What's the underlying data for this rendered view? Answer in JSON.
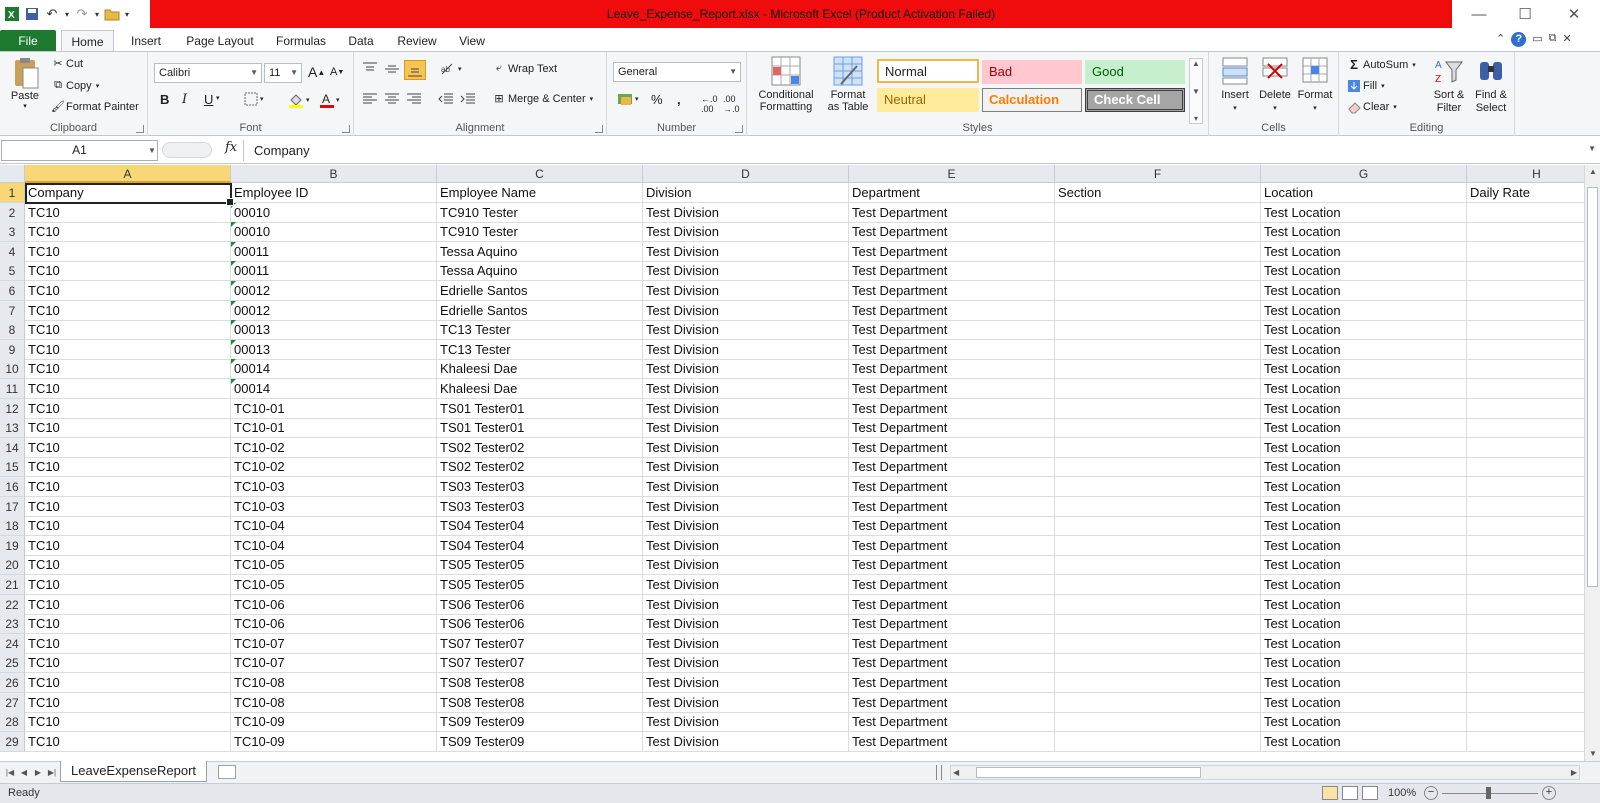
{
  "titlebar": {
    "title": "Leave_Expense_Report.xlsx  -  Microsoft Excel (Product Activation Failed)"
  },
  "tabs": {
    "file": "File",
    "items": [
      "Home",
      "Insert",
      "Page Layout",
      "Formulas",
      "Data",
      "Review",
      "View"
    ]
  },
  "ribbon": {
    "clipboard": {
      "label": "Clipboard",
      "paste": "Paste",
      "cut": "Cut",
      "copy": "Copy",
      "format_painter": "Format Painter"
    },
    "font": {
      "label": "Font",
      "name": "Calibri",
      "size": "11"
    },
    "alignment": {
      "label": "Alignment",
      "wrap": "Wrap Text",
      "merge": "Merge & Center"
    },
    "number": {
      "label": "Number",
      "format": "General"
    },
    "styles": {
      "label": "Styles",
      "conditional": [
        "Conditional",
        "Formatting"
      ],
      "format_table": [
        "Format",
        "as Table"
      ],
      "normal": "Normal",
      "bad": "Bad",
      "good": "Good",
      "neutral": "Neutral",
      "calculation": "Calculation",
      "check": "Check Cell"
    },
    "cells": {
      "label": "Cells",
      "insert": "Insert",
      "delete": "Delete",
      "format": "Format"
    },
    "editing": {
      "label": "Editing",
      "autosum": "AutoSum",
      "fill": "Fill",
      "clear": "Clear",
      "sort": [
        "Sort &",
        "Filter"
      ],
      "find": [
        "Find &",
        "Select"
      ]
    }
  },
  "formula_bar": {
    "name_box": "A1",
    "fx": "fx",
    "value": "Company"
  },
  "sheet": {
    "columns": [
      "A",
      "B",
      "C",
      "D",
      "E",
      "F",
      "G",
      "H"
    ],
    "row_numbers": [
      "1",
      "2",
      "3",
      "4",
      "5",
      "6",
      "7",
      "8",
      "9",
      "10",
      "11",
      "12",
      "13",
      "14",
      "15",
      "16",
      "17",
      "18",
      "19",
      "20",
      "21",
      "22",
      "23",
      "24",
      "25",
      "26",
      "27",
      "28",
      "29"
    ],
    "header": [
      "Company",
      "Employee ID",
      "Employee Name",
      "Division",
      "Department",
      "Section",
      "Location",
      "Daily Rate"
    ],
    "rows": [
      [
        "TC10",
        "00010",
        "TC910 Tester",
        "Test Division",
        "Test Department",
        "",
        "Test Location",
        ""
      ],
      [
        "TC10",
        "00010",
        "TC910 Tester",
        "Test Division",
        "Test Department",
        "",
        "Test Location",
        ""
      ],
      [
        "TC10",
        "00011",
        "Tessa Aquino",
        "Test Division",
        "Test Department",
        "",
        "Test Location",
        ""
      ],
      [
        "TC10",
        "00011",
        "Tessa Aquino",
        "Test Division",
        "Test Department",
        "",
        "Test Location",
        ""
      ],
      [
        "TC10",
        "00012",
        "Edrielle Santos",
        "Test Division",
        "Test Department",
        "",
        "Test Location",
        ""
      ],
      [
        "TC10",
        "00012",
        "Edrielle Santos",
        "Test Division",
        "Test Department",
        "",
        "Test Location",
        ""
      ],
      [
        "TC10",
        "00013",
        "TC13 Tester",
        "Test Division",
        "Test Department",
        "",
        "Test Location",
        ""
      ],
      [
        "TC10",
        "00013",
        "TC13 Tester",
        "Test Division",
        "Test Department",
        "",
        "Test Location",
        ""
      ],
      [
        "TC10",
        "00014",
        "Khaleesi Dae",
        "Test Division",
        "Test Department",
        "",
        "Test Location",
        ""
      ],
      [
        "TC10",
        "00014",
        "Khaleesi Dae",
        "Test Division",
        "Test Department",
        "",
        "Test Location",
        ""
      ],
      [
        "TC10",
        "TC10-01",
        "TS01 Tester01",
        "Test Division",
        "Test Department",
        "",
        "Test Location",
        ""
      ],
      [
        "TC10",
        "TC10-01",
        "TS01 Tester01",
        "Test Division",
        "Test Department",
        "",
        "Test Location",
        ""
      ],
      [
        "TC10",
        "TC10-02",
        "TS02 Tester02",
        "Test Division",
        "Test Department",
        "",
        "Test Location",
        ""
      ],
      [
        "TC10",
        "TC10-02",
        "TS02 Tester02",
        "Test Division",
        "Test Department",
        "",
        "Test Location",
        ""
      ],
      [
        "TC10",
        "TC10-03",
        "TS03 Tester03",
        "Test Division",
        "Test Department",
        "",
        "Test Location",
        ""
      ],
      [
        "TC10",
        "TC10-03",
        "TS03 Tester03",
        "Test Division",
        "Test Department",
        "",
        "Test Location",
        ""
      ],
      [
        "TC10",
        "TC10-04",
        "TS04 Tester04",
        "Test Division",
        "Test Department",
        "",
        "Test Location",
        ""
      ],
      [
        "TC10",
        "TC10-04",
        "TS04 Tester04",
        "Test Division",
        "Test Department",
        "",
        "Test Location",
        ""
      ],
      [
        "TC10",
        "TC10-05",
        "TS05 Tester05",
        "Test Division",
        "Test Department",
        "",
        "Test Location",
        ""
      ],
      [
        "TC10",
        "TC10-05",
        "TS05 Tester05",
        "Test Division",
        "Test Department",
        "",
        "Test Location",
        ""
      ],
      [
        "TC10",
        "TC10-06",
        "TS06 Tester06",
        "Test Division",
        "Test Department",
        "",
        "Test Location",
        ""
      ],
      [
        "TC10",
        "TC10-06",
        "TS06 Tester06",
        "Test Division",
        "Test Department",
        "",
        "Test Location",
        ""
      ],
      [
        "TC10",
        "TC10-07",
        "TS07 Tester07",
        "Test Division",
        "Test Department",
        "",
        "Test Location",
        ""
      ],
      [
        "TC10",
        "TC10-07",
        "TS07 Tester07",
        "Test Division",
        "Test Department",
        "",
        "Test Location",
        ""
      ],
      [
        "TC10",
        "TC10-08",
        "TS08 Tester08",
        "Test Division",
        "Test Department",
        "",
        "Test Location",
        ""
      ],
      [
        "TC10",
        "TC10-08",
        "TS08 Tester08",
        "Test Division",
        "Test Department",
        "",
        "Test Location",
        ""
      ],
      [
        "TC10",
        "TC10-09",
        "TS09 Tester09",
        "Test Division",
        "Test Department",
        "",
        "Test Location",
        ""
      ],
      [
        "TC10",
        "TC10-09",
        "TS09 Tester09",
        "Test Division",
        "Test Department",
        "",
        "Test Location",
        ""
      ]
    ]
  },
  "sheet_tab": {
    "name": "LeaveExpenseReport"
  },
  "status": {
    "text": "Ready",
    "zoom": "100%"
  },
  "colors": {
    "title_bar": "#f00c0c",
    "file_tab": "#1e7a2e",
    "selection_header": "#f8d776"
  }
}
